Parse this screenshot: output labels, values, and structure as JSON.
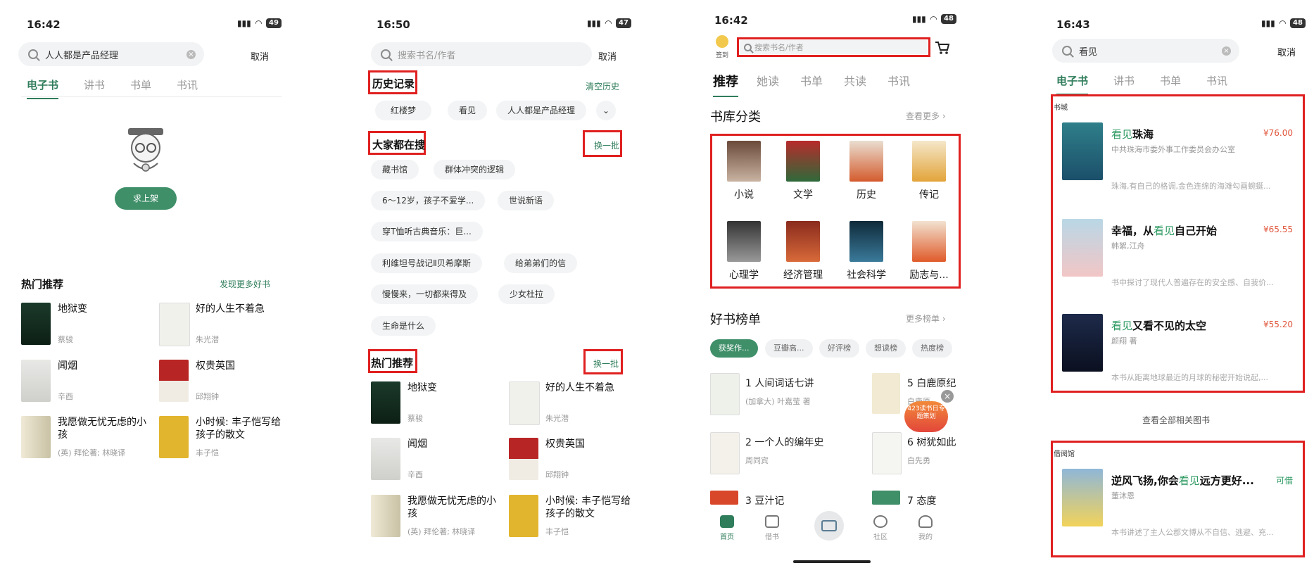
{
  "s1": {
    "time": "16:42",
    "battery": "49",
    "search_value": "人人都是产品经理",
    "cancel": "取消",
    "tabs": [
      "电子书",
      "讲书",
      "书单",
      "书讯"
    ],
    "request_btn": "求上架",
    "hot_title": "热门推荐",
    "discover_more": "发现更多好书",
    "books": [
      {
        "title": "地狱变",
        "author": "蔡骏"
      },
      {
        "title": "好的人生不着急",
        "author": "朱光潜"
      },
      {
        "title": "闻烟",
        "author": "辛酉"
      },
      {
        "title": "权贵英国",
        "author": "邱翔钟"
      },
      {
        "title": "我愿做无忧无虑的小孩",
        "author": "(英) 拜伦著; 林晓译"
      },
      {
        "title": "小时候: 丰子恺写给孩子的散文",
        "author": "丰子恺"
      }
    ]
  },
  "s2": {
    "time": "16:50",
    "battery": "47",
    "search_placeholder": "搜索书名/作者",
    "cancel": "取消",
    "history_title": "历史记录",
    "clear_history": "清空历史",
    "history": [
      "红楼梦",
      "看见",
      "人人都是产品经理"
    ],
    "hot_search_title": "大家都在搜",
    "refresh": "换一批",
    "hot_search": [
      "藏书馆",
      "群体冲突的逻辑",
      "6～12岁，孩子不爱学...",
      "世说新语",
      "穿T恤听古典音乐：巨...",
      "利维坦号战记Ⅱ贝希摩斯",
      "给弟弟们的信",
      "慢慢来，一切都来得及",
      "少女杜拉",
      "生命是什么"
    ],
    "hot_title": "热门推荐",
    "refresh2": "换一批",
    "books": [
      {
        "title": "地狱变",
        "author": "蔡骏"
      },
      {
        "title": "好的人生不着急",
        "author": "朱光潜"
      },
      {
        "title": "闻烟",
        "author": "辛酉"
      },
      {
        "title": "权贵英国",
        "author": "邱翔钟"
      },
      {
        "title": "我愿做无忧无虑的小孩",
        "author": "(英) 拜伦著; 林晓译"
      },
      {
        "title": "小时候: 丰子恺写给孩子的散文",
        "author": "丰子恺"
      }
    ]
  },
  "s3": {
    "time": "16:42",
    "battery": "48",
    "signin": "签到",
    "search_placeholder": "搜索书名/作者",
    "tabs": [
      "推荐",
      "她读",
      "书单",
      "共读",
      "书讯"
    ],
    "category_title": "书库分类",
    "see_more": "查看更多 ›",
    "categories": [
      "小说",
      "文学",
      "历史",
      "传记",
      "心理学",
      "经济管理",
      "社会科学",
      "励志与..."
    ],
    "ranking_title": "好书榜单",
    "more_lists": "更多榜单 ›",
    "pills": [
      "获奖作...",
      "豆瓣高...",
      "好评榜",
      "想读榜",
      "热度榜"
    ],
    "ranks": [
      {
        "no": "1",
        "title": "人间词话七讲",
        "author": "(加拿大) 叶嘉莹 著"
      },
      {
        "no": "5",
        "title": "白鹿原纪",
        "author": "白鹿原"
      },
      {
        "no": "2",
        "title": "一个人的编年史",
        "author": "周同宾"
      },
      {
        "no": "6",
        "title": "树犹如此",
        "author": "白先勇"
      },
      {
        "no": "3",
        "title": "豆汁记",
        "author": ""
      },
      {
        "no": "7",
        "title": "态度",
        "author": ""
      }
    ],
    "badge": "423读书日专题策划",
    "nav": [
      "首页",
      "借书",
      "",
      "社区",
      "我的"
    ]
  },
  "s4": {
    "time": "16:43",
    "battery": "48",
    "search_value": "看见",
    "cancel": "取消",
    "tabs": [
      "电子书",
      "讲书",
      "书单",
      "书讯"
    ],
    "store_label": "书城",
    "results": [
      {
        "hl": "看见",
        "rest": "珠海",
        "price": "¥76.00",
        "author": "中共珠海市委外事工作委员会办公室",
        "desc": "珠海,有自己的格调,金色连绵的海滩勾画蜿蜒..."
      },
      {
        "pre": "幸福，从",
        "hl": "看见",
        "rest": "自己开始",
        "price": "¥65.55",
        "author": "韩絮,江舟",
        "desc": "书中探讨了现代人普遍存在的安全感、自我价..."
      },
      {
        "hl": "看见",
        "rest": "又看不见的太空",
        "price": "¥55.20",
        "author": "颜翔 著",
        "desc": "本书从距离地球最近的月球的秘密开始说起,..."
      }
    ],
    "see_all": "查看全部相关图书",
    "library_label": "借阅馆",
    "lib_result": {
      "pre": "逆风飞扬,你会",
      "hl": "看见",
      "rest": "远方更好...",
      "status": "可借",
      "author": "董沐恩",
      "desc": "本书讲述了主人公郡文博从不自信、逃避、充..."
    }
  },
  "colors": {
    "green": "#2f7d5b",
    "red": "#e02020",
    "price": "#e0553a"
  }
}
